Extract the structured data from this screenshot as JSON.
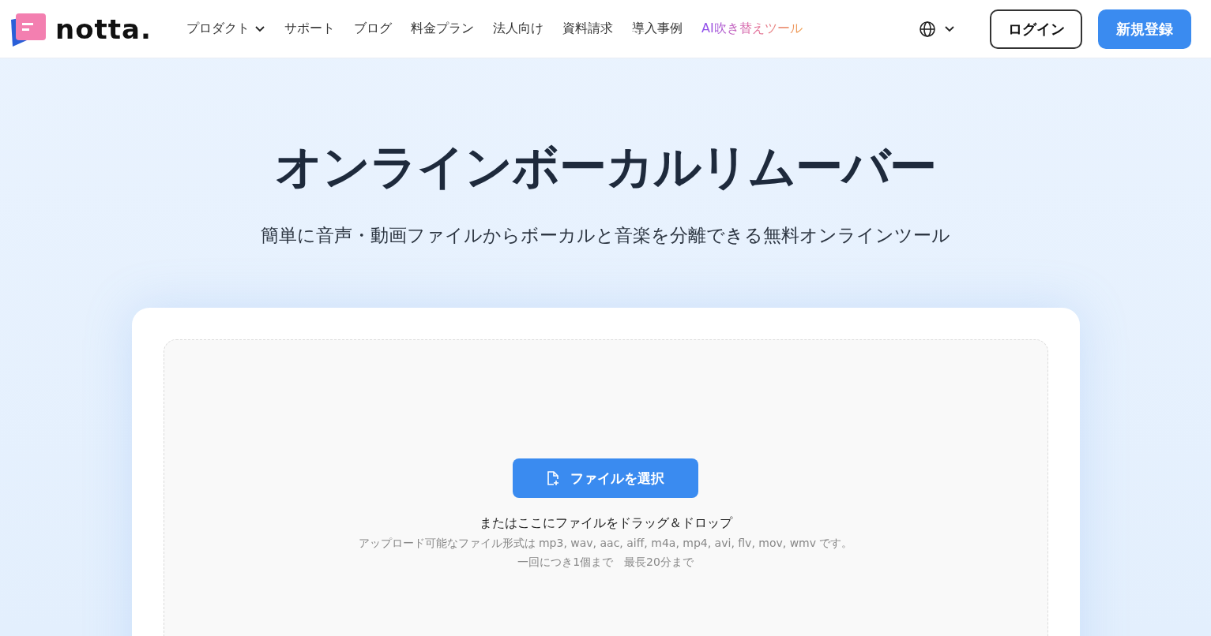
{
  "header": {
    "logo_text": "notta.",
    "nav": [
      {
        "label": "プロダクト",
        "kind": "dropdown"
      },
      {
        "label": "サポート",
        "kind": "link"
      },
      {
        "label": "ブログ",
        "kind": "link"
      },
      {
        "label": "料金プラン",
        "kind": "link"
      },
      {
        "label": "法人向け",
        "kind": "link"
      },
      {
        "label": "資料請求",
        "kind": "link"
      },
      {
        "label": "導入事例",
        "kind": "link"
      },
      {
        "label": "AI吹き替えツール",
        "kind": "highlight"
      }
    ],
    "login": "ログイン",
    "signup": "新規登録"
  },
  "hero": {
    "title": "オンラインボーカルリムーバー",
    "subtitle": "簡単に音声・動画ファイルからボーカルと音楽を分離できる無料オンラインツール"
  },
  "upload": {
    "button": "ファイルを選択",
    "drop_hint": "またはここにファイルをドラッグ＆ドロップ",
    "formats": "アップロード可能なファイル形式は mp3, wav, aac, aiff, m4a, mp4, avi, flv, mov, wmv です。",
    "limits": "一回につき1個まで　最長20分まで"
  }
}
